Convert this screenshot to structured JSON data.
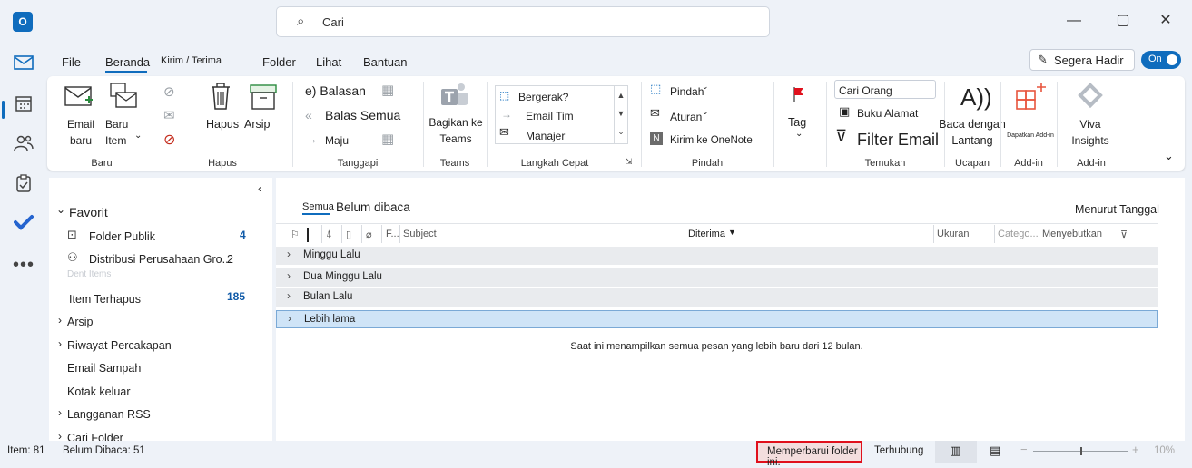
{
  "search": {
    "placeholder": "Cari"
  },
  "window": {
    "minimize": "—",
    "maximize": "▢",
    "close": "✕"
  },
  "app_logo": "O",
  "rail": [
    "mail-icon",
    "calendar-icon",
    "people-icon",
    "tasks-icon",
    "todo-icon",
    "more-icon"
  ],
  "menu": {
    "tabs": [
      "File",
      "Beranda",
      "Kirim / Terima",
      "Folder",
      "Lihat",
      "Bantuan"
    ],
    "coming_soon": "Segera Hadir",
    "toggle": "On"
  },
  "ribbon": {
    "baru": {
      "new_email": "Email baru",
      "new_email_l1": "Email",
      "new_email_l2": "baru",
      "new_item_l1": "Baru",
      "new_item_l2": "Item",
      "label": "Baru"
    },
    "hapus": {
      "delete": "Hapus",
      "archive": "Arsip",
      "label": "Hapus"
    },
    "tanggapi": {
      "reply": "e) Balasan",
      "reply_all": "Balas Semua",
      "forward": "Maju",
      "label": "Tanggapi"
    },
    "teams": {
      "share_l1": "Bagikan ke",
      "share_l2": "Teams",
      "label": "Teams"
    },
    "quick": {
      "items": [
        "Bergerak?",
        "Email Tim",
        "Manajer"
      ],
      "label": "Langkah Cepat"
    },
    "pindah": {
      "move": "Pindah",
      "rules": "Aturan",
      "onenote": "Kirim ke OneNote",
      "label": "Pindah"
    },
    "tag": {
      "label": "Tag"
    },
    "temukan": {
      "search_people": "Cari Orang",
      "address_book": "Buku Alamat",
      "filter": "Filter Email",
      "label": "Temukan"
    },
    "ucapan": {
      "read_aloud_icon": "A))",
      "read_l1": "Baca dengan",
      "read_l2": "Lantang",
      "label": "Ucapan"
    },
    "addin": {
      "get": "Dapatkan Add-in",
      "label": "Add-in"
    },
    "viva": {
      "l1": "Viva",
      "l2": "Insights",
      "label": "Add-in"
    }
  },
  "folders": {
    "favorites_label": "Favorit",
    "items": [
      {
        "name": "Folder Publik",
        "count": "4"
      },
      {
        "name": "Distribusi Perusahaan Gro...",
        "count": "2"
      },
      {
        "name": "Item Terhapus",
        "count": "185"
      },
      {
        "name": "Arsip",
        "count": ""
      },
      {
        "name": "Riwayat Percakapan",
        "count": ""
      },
      {
        "name": "Email Sampah",
        "count": ""
      },
      {
        "name": "Kotak keluar",
        "count": ""
      },
      {
        "name": "Langganan RSS",
        "count": ""
      },
      {
        "name": "Cari Folder",
        "count": ""
      }
    ],
    "faded": "Dent Items"
  },
  "messages": {
    "filter_all": "Semua",
    "filter_unread": "Belum dibaca",
    "sort": "Menurut Tanggal",
    "columns": {
      "from": "F...",
      "subject": "Subject",
      "received": "Diterima",
      "size": "Ukuran",
      "category": "Catego...",
      "mention": "Menyebutkan"
    },
    "groups": [
      "Minggu Lalu",
      "Dua Minggu Lalu",
      "Bulan Lalu",
      "Lebih lama"
    ],
    "notice": "Saat ini menampilkan semua pesan yang lebih baru dari 12 bulan."
  },
  "status": {
    "items": "Item: 81",
    "unread": "Belum Dibaca: 51",
    "updating": "Memperbarui folder ini.",
    "connected": "Terhubung",
    "zoom": "10%"
  },
  "colors": {
    "accent": "#0f6cbd",
    "highlight": "#cfe4f7",
    "alert_border": "#e0101c",
    "addin_red": "#e8553e"
  }
}
